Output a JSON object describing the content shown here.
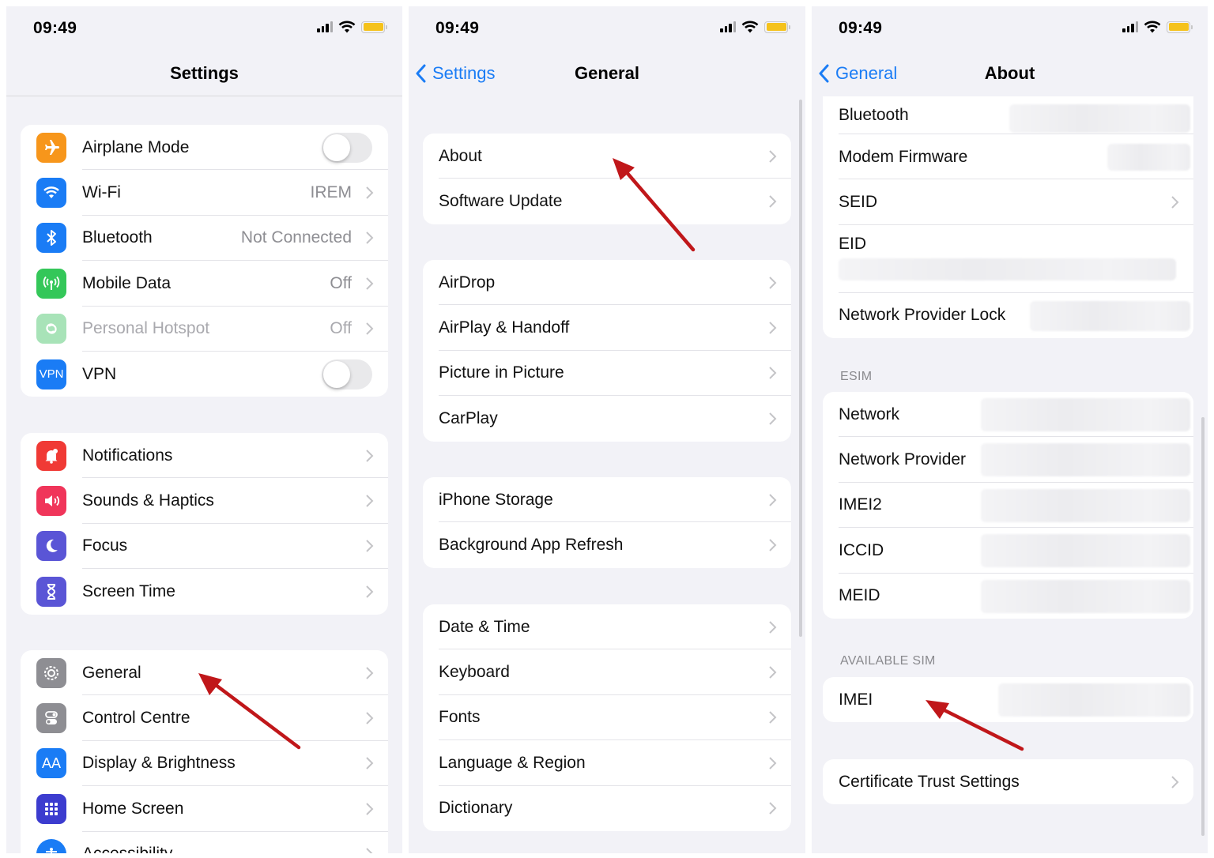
{
  "status_time": "09:49",
  "colors": {
    "accent": "#1a7cf5",
    "annotation_arrow": "#c0171a"
  },
  "panel1": {
    "nav_title": "Settings",
    "group1": [
      {
        "label": "Airplane Mode",
        "icon": "airplane-icon",
        "toggle": "off"
      },
      {
        "label": "Wi-Fi",
        "value": "IREM",
        "icon": "wifi-icon"
      },
      {
        "label": "Bluetooth",
        "value": "Not Connected",
        "icon": "bluetooth-icon"
      },
      {
        "label": "Mobile Data",
        "value": "Off",
        "icon": "antenna-icon"
      },
      {
        "label": "Personal Hotspot",
        "value": "Off",
        "icon": "hotspot-icon"
      },
      {
        "label": "VPN",
        "icon_text": "VPN",
        "toggle": "off"
      }
    ],
    "group2": [
      {
        "label": "Notifications",
        "icon": "bell-icon"
      },
      {
        "label": "Sounds & Haptics",
        "icon": "speaker-icon"
      },
      {
        "label": "Focus",
        "icon": "moon-icon"
      },
      {
        "label": "Screen Time",
        "icon": "hourglass-icon"
      }
    ],
    "group3": [
      {
        "label": "General",
        "icon": "gear-icon"
      },
      {
        "label": "Control Centre",
        "icon": "switches-icon"
      },
      {
        "label": "Display & Brightness",
        "icon_text": "AA"
      },
      {
        "label": "Home Screen",
        "icon": "grid-icon"
      },
      {
        "label": "Accessibility",
        "icon": "accessibility-icon"
      }
    ]
  },
  "panel2": {
    "back_label": "Settings",
    "nav_title": "General",
    "group1": [
      "About",
      "Software Update"
    ],
    "group2": [
      "AirDrop",
      "AirPlay & Handoff",
      "Picture in Picture",
      "CarPlay"
    ],
    "group3": [
      "iPhone Storage",
      "Background App Refresh"
    ],
    "group4": [
      "Date & Time",
      "Keyboard",
      "Fonts",
      "Language & Region",
      "Dictionary"
    ]
  },
  "panel3": {
    "back_label": "General",
    "nav_title": "About",
    "group1": [
      "Bluetooth",
      "Modem Firmware",
      "SEID",
      "EID",
      "Network Provider Lock"
    ],
    "esim_header": "ESIM",
    "esim": [
      "Network",
      "Network Provider",
      "IMEI2",
      "ICCID",
      "MEID"
    ],
    "sim_header": "AVAILABLE SIM",
    "sim": [
      "IMEI"
    ],
    "cert": "Certificate Trust Settings"
  }
}
